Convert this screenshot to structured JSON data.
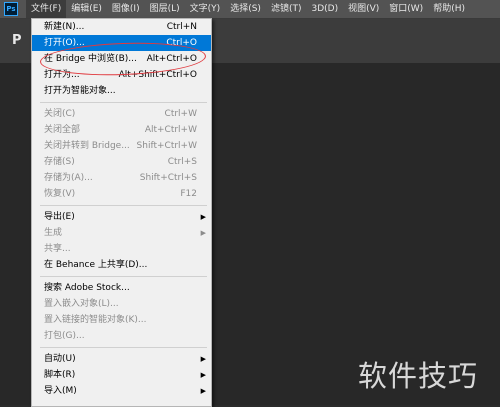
{
  "app": {
    "logo": "Ps"
  },
  "menubar": [
    {
      "label": "文件(F)",
      "active": true
    },
    {
      "label": "编辑(E)"
    },
    {
      "label": "图像(I)"
    },
    {
      "label": "图层(L)"
    },
    {
      "label": "文字(Y)"
    },
    {
      "label": "选择(S)"
    },
    {
      "label": "滤镜(T)"
    },
    {
      "label": "3D(D)"
    },
    {
      "label": "视图(V)"
    },
    {
      "label": "窗口(W)"
    },
    {
      "label": "帮助(H)"
    }
  ],
  "tool_glyph": "P",
  "file_menu": {
    "groups": [
      [
        {
          "label": "新建(N)...",
          "shortcut": "Ctrl+N"
        },
        {
          "label": "打开(O)...",
          "shortcut": "Ctrl+O",
          "highlight": true
        },
        {
          "label": "在 Bridge 中浏览(B)...",
          "shortcut": "Alt+Ctrl+O"
        },
        {
          "label": "打开为...",
          "shortcut": "Alt+Shift+Ctrl+O"
        },
        {
          "label": "打开为智能对象..."
        }
      ],
      [
        {
          "label": "关闭(C)",
          "shortcut": "Ctrl+W",
          "disabled": true
        },
        {
          "label": "关闭全部",
          "shortcut": "Alt+Ctrl+W",
          "disabled": true
        },
        {
          "label": "关闭并转到 Bridge...",
          "shortcut": "Shift+Ctrl+W",
          "disabled": true
        },
        {
          "label": "存储(S)",
          "shortcut": "Ctrl+S",
          "disabled": true
        },
        {
          "label": "存储为(A)...",
          "shortcut": "Shift+Ctrl+S",
          "disabled": true
        },
        {
          "label": "恢复(V)",
          "shortcut": "F12",
          "disabled": true
        }
      ],
      [
        {
          "label": "导出(E)",
          "submenu": true
        },
        {
          "label": "生成",
          "submenu": true,
          "disabled": true
        },
        {
          "label": "共享...",
          "disabled": true
        },
        {
          "label": "在 Behance 上共享(D)..."
        }
      ],
      [
        {
          "label": "搜索 Adobe Stock..."
        },
        {
          "label": "置入嵌入对象(L)...",
          "disabled": true
        },
        {
          "label": "置入链接的智能对象(K)...",
          "disabled": true
        },
        {
          "label": "打包(G)...",
          "disabled": true
        }
      ],
      [
        {
          "label": "自动(U)",
          "submenu": true
        },
        {
          "label": "脚本(R)",
          "submenu": true
        },
        {
          "label": "导入(M)",
          "submenu": true
        }
      ]
    ]
  },
  "watermark": "软件技巧",
  "colors": {
    "highlight": "#0078d7",
    "annotation_oval": "#e0393e",
    "brand": "#31a8ff"
  }
}
